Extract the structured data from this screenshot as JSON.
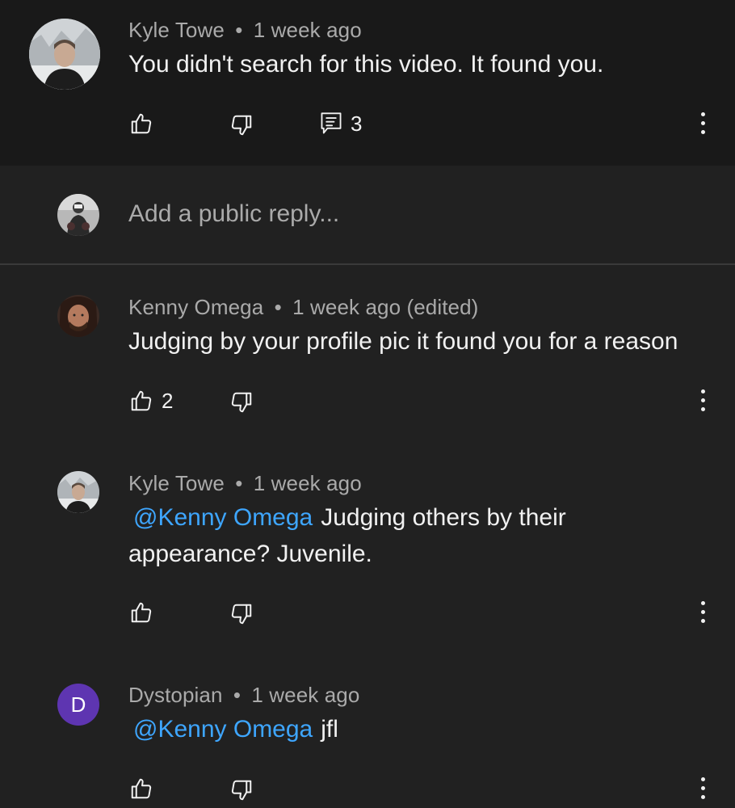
{
  "top_comment": {
    "author": "Kyle Towe",
    "time": "1 week ago",
    "text": "You didn't search for this video. It found you.",
    "reply_count": "3"
  },
  "reply_box": {
    "placeholder": "Add a public reply..."
  },
  "replies": [
    {
      "author": "Kenny Omega",
      "time": "1 week ago (edited)",
      "text": "Judging by your profile pic it found you for a reason",
      "like_count": "2"
    },
    {
      "author": "Kyle Towe",
      "time": "1 week ago",
      "mention": "@Kenny Omega",
      "text_line1": "Judging others by their",
      "text_line2": "appearance? Juvenile."
    },
    {
      "author": "Dystopian",
      "time": "1 week ago",
      "avatar_letter": "D",
      "mention": "@Kenny Omega",
      "text": "jfl"
    }
  ],
  "separator": "•",
  "colors": {
    "background": "#212121",
    "top_comment_background": "#191919",
    "mention": "#3ea6ff",
    "secondary_text": "#aaaaaa",
    "avatar_purple": "#5e35b1"
  },
  "icons": [
    "thumbs-up-icon",
    "thumbs-down-icon",
    "comment-icon",
    "more-vert-icon"
  ]
}
